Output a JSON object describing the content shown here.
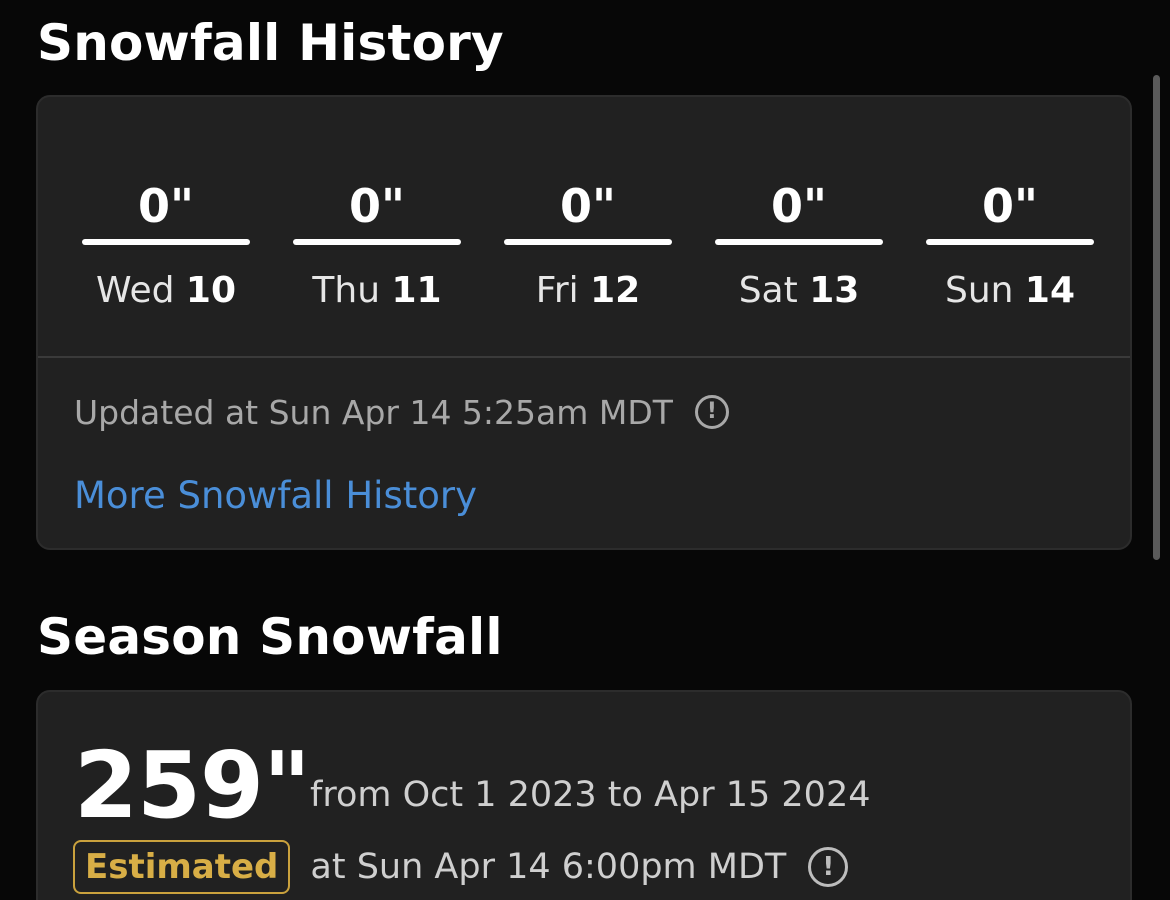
{
  "snowfall_history": {
    "title": "Snowfall History",
    "days": [
      {
        "amount": "0\"",
        "weekday": "Wed",
        "date": "10"
      },
      {
        "amount": "0\"",
        "weekday": "Thu",
        "date": "11"
      },
      {
        "amount": "0\"",
        "weekday": "Fri",
        "date": "12"
      },
      {
        "amount": "0\"",
        "weekday": "Sat",
        "date": "13"
      },
      {
        "amount": "0\"",
        "weekday": "Sun",
        "date": "14"
      }
    ],
    "updated_text": "Updated at Sun Apr 14 5:25am MDT",
    "info_icon": "info-circle-icon",
    "more_link": "More Snowfall History"
  },
  "season_snowfall": {
    "title": "Season Snowfall",
    "total": "259\"",
    "range_text": "from Oct 1 2023 to Apr 15 2024",
    "badge": "Estimated",
    "estimated_at": "at Sun Apr 14 6:00pm MDT",
    "info_icon": "info-circle-icon"
  },
  "colors": {
    "background": "#070707",
    "card": "#212121",
    "link": "#4a8ed8",
    "badge": "#d8ae46"
  }
}
